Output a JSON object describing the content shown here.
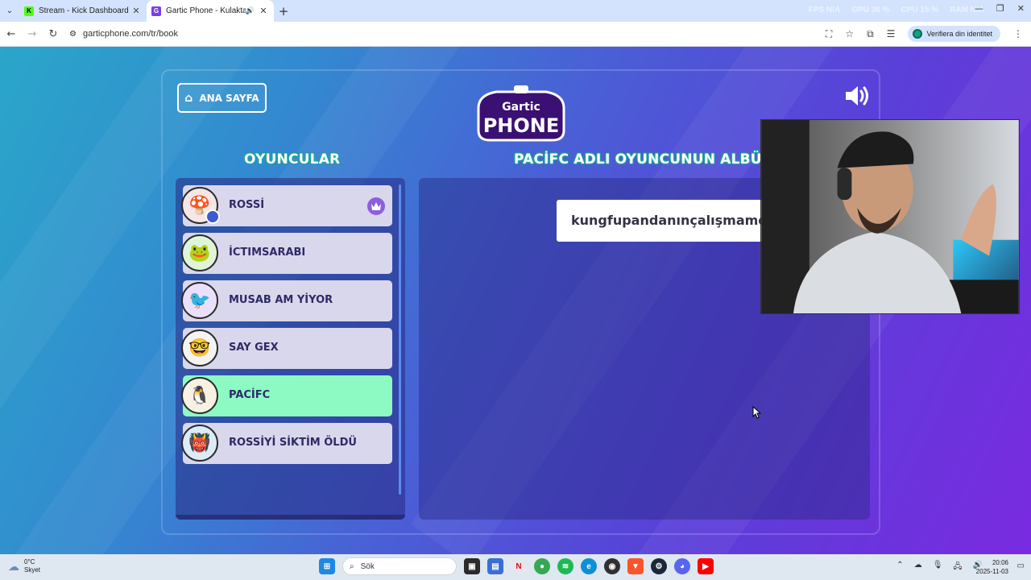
{
  "browser": {
    "tabs": [
      {
        "title": "Stream - Kick Dashboard",
        "favicon": "kick-icon",
        "color": "#53fc18"
      },
      {
        "title": "Gartic Phone - Kulaktan Kul",
        "favicon": "gartic-icon",
        "color": "#7b3fe4"
      }
    ],
    "perf": {
      "fps_label": "FPS",
      "fps_value": "N/A",
      "gpu_label": "GPU",
      "gpu_value": "36 %",
      "cpu_label": "CPU",
      "cpu_value": "15 %",
      "ram_label": "RAM",
      "ram_value": "N/A"
    },
    "url": "garticphone.com/tr/book",
    "profile_label": "Verifiera din identitet"
  },
  "game": {
    "home_button": "ANA SAYFA",
    "logo_top": "Gartic",
    "logo_bottom": "PHONE",
    "players_heading": "OYUNCULAR",
    "album_heading": "PACİFC ADLI OYUNCUNUN ALBÜMÜ",
    "players": [
      {
        "name": "ROSSİ",
        "host": true,
        "active": false,
        "avatar": "mushroom-avatar"
      },
      {
        "name": "İCTIMSARABI",
        "host": false,
        "active": false,
        "avatar": "frog-avatar"
      },
      {
        "name": "MUSAB AM YİYOR",
        "host": false,
        "active": false,
        "avatar": "bird-avatar"
      },
      {
        "name": "SAY GEX",
        "host": false,
        "active": false,
        "avatar": "glasses-avatar"
      },
      {
        "name": "PACİFC",
        "host": false,
        "active": true,
        "avatar": "penguin-avatar"
      },
      {
        "name": "ROSSİYİ SİKTİM ÖLDÜ",
        "host": false,
        "active": false,
        "avatar": "monster-avatar"
      }
    ],
    "album_entry": "kungfupandanınçalışmamek"
  },
  "taskbar": {
    "weather_temp": "0°C",
    "weather_desc": "Skyet",
    "search_placeholder": "Sök",
    "time": "20:06",
    "date": "2025-11-03"
  }
}
